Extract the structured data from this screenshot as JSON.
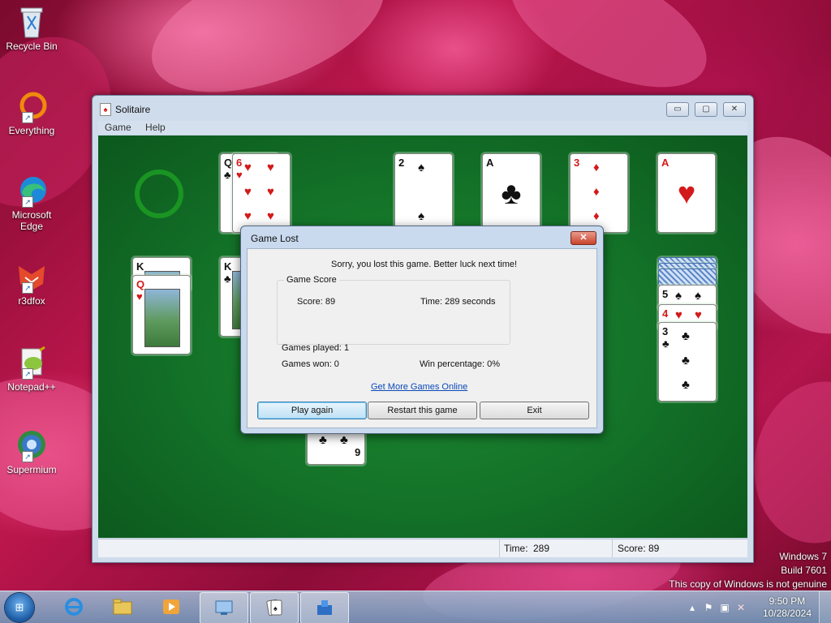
{
  "desktop": {
    "icons": [
      {
        "label": "Recycle Bin"
      },
      {
        "label": "Everything"
      },
      {
        "label": "Microsoft Edge"
      },
      {
        "label": "r3dfox"
      },
      {
        "label": "Notepad++"
      },
      {
        "label": "Supermium"
      }
    ],
    "watermark": {
      "line1": "Windows 7",
      "line2": "Build 7601",
      "line3": "This copy of Windows is not genuine"
    }
  },
  "window": {
    "title": "Solitaire",
    "buttons": {
      "minimize": "▭",
      "maximize": "▢",
      "close": "✕"
    },
    "menu": [
      {
        "label": "Game"
      },
      {
        "label": "Help"
      }
    ],
    "status": {
      "time_label": "Time:",
      "time_value": "289",
      "score_label": "Score:",
      "score_value": "89"
    }
  },
  "cards": {
    "waste_top": {
      "rank": "Q",
      "suit": "♣",
      "second_rank": "6",
      "second_suit": "♥"
    },
    "foundations": [
      {
        "rank": "2",
        "suit": "♠",
        "color": "black"
      },
      {
        "rank": "A",
        "suit": "♣",
        "color": "black"
      },
      {
        "rank": "3",
        "suit": "♦",
        "color": "red"
      },
      {
        "rank": "A",
        "suit": "♥",
        "color": "red"
      }
    ],
    "tableau_1": [
      {
        "rank": "K",
        "suit": "♠"
      },
      {
        "rank": "Q",
        "suit": "♥"
      }
    ],
    "tableau_2": [
      {
        "rank": "K",
        "suit": "♣"
      }
    ],
    "tableau_7": [
      {
        "rank": "5",
        "suit": "♠"
      },
      {
        "rank": "4",
        "suit": "♥"
      },
      {
        "rank": "3",
        "suit": "♣"
      }
    ],
    "lower_card": {
      "rank": "6",
      "suit": "♣"
    }
  },
  "dialog": {
    "title": "Game Lost",
    "close": "✕",
    "message": "Sorry, you lost this game. Better luck next time!",
    "group_label": "Game Score",
    "score_text": "Score: 89",
    "time_text": "Time:  289 seconds",
    "games_played": "Games played: 1",
    "games_won": "Games won: 0",
    "win_percentage": "Win percentage: 0%",
    "link": "Get More Games Online",
    "buttons": {
      "play_again": "Play again",
      "restart": "Restart this game",
      "exit": "Exit"
    }
  },
  "taskbar": {
    "clock_time": "9:50 PM",
    "clock_date": "10/28/2024"
  }
}
